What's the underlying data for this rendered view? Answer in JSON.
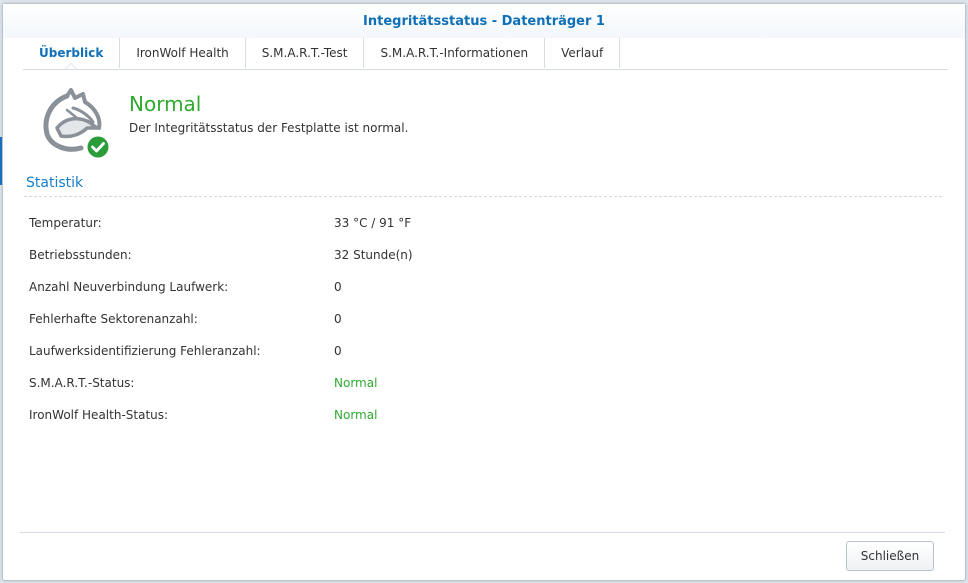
{
  "window": {
    "title": "Integritätsstatus - Datenträger 1"
  },
  "tabs": [
    {
      "label": "Überblick",
      "active": true
    },
    {
      "label": "IronWolf Health",
      "active": false
    },
    {
      "label": "S.M.A.R.T.-Test",
      "active": false
    },
    {
      "label": "S.M.A.R.T.-Informationen",
      "active": false
    },
    {
      "label": "Verlauf",
      "active": false
    }
  ],
  "status": {
    "title": "Normal",
    "description": "Der Integritätsstatus der Festplatte ist normal.",
    "icon": "ironwolf-logo-icon",
    "badge_icon": "check-circle-icon",
    "color": "#2eaa2e"
  },
  "statistics": {
    "title": "Statistik",
    "rows": [
      {
        "label": "Temperatur:",
        "value": "33 °C / 91 °F"
      },
      {
        "label": "Betriebsstunden:",
        "value": "32 Stunde(n)"
      },
      {
        "label": "Anzahl Neuverbindung Laufwerk:",
        "value": "0"
      },
      {
        "label": "Fehlerhafte Sektorenanzahl:",
        "value": "0"
      },
      {
        "label": "Laufwerksidentifizierung Fehleranzahl:",
        "value": "0"
      },
      {
        "label": "S.M.A.R.T.-Status:",
        "value": "Normal"
      },
      {
        "label": "IronWolf Health-Status:",
        "value": "Normal"
      }
    ]
  },
  "footer": {
    "close_label": "Schließen"
  },
  "colors": {
    "accent": "#0f70b8",
    "ok": "#2eaa2e"
  }
}
